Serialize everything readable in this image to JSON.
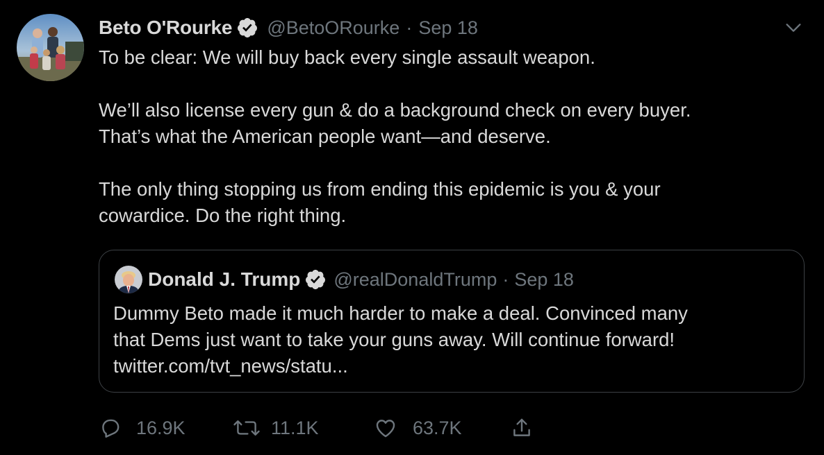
{
  "tweet": {
    "author": {
      "name": "Beto O'Rourke",
      "handle": "@BetoORourke",
      "date": "Sep 18",
      "verified": true
    },
    "text": {
      "line1": "To be clear: We will buy back every single assault weapon.",
      "line2": "We’ll also license every gun & do a background check on every buyer.",
      "line3": "That’s what the American people want—and deserve.",
      "line4": "The only thing stopping us from ending this epidemic is you & your",
      "line5": "cowardice. Do the right thing."
    },
    "separator": "·"
  },
  "quoted": {
    "author": {
      "name": "Donald J. Trump",
      "handle": "@realDonaldTrump",
      "date": "Sep 18",
      "verified": true
    },
    "separator": "·",
    "text": {
      "line1": "Dummy Beto made it much harder to make a deal. Convinced many",
      "line2": "that Dems just want to take your guns away. Will continue forward!",
      "line3": "twitter.com/tvt_news/statu..."
    }
  },
  "actions": {
    "replies": "16.9K",
    "retweets": "11.1K",
    "likes": "63.7K"
  },
  "icons": {
    "reply": "reply-icon",
    "retweet": "retweet-icon",
    "like": "heart-icon",
    "share": "share-icon",
    "more": "chevron-down-icon",
    "verified": "verified-badge-icon"
  },
  "colors": {
    "background": "#000000",
    "text": "#d9d9d9",
    "muted": "#6e767d",
    "border": "#3d4145"
  }
}
